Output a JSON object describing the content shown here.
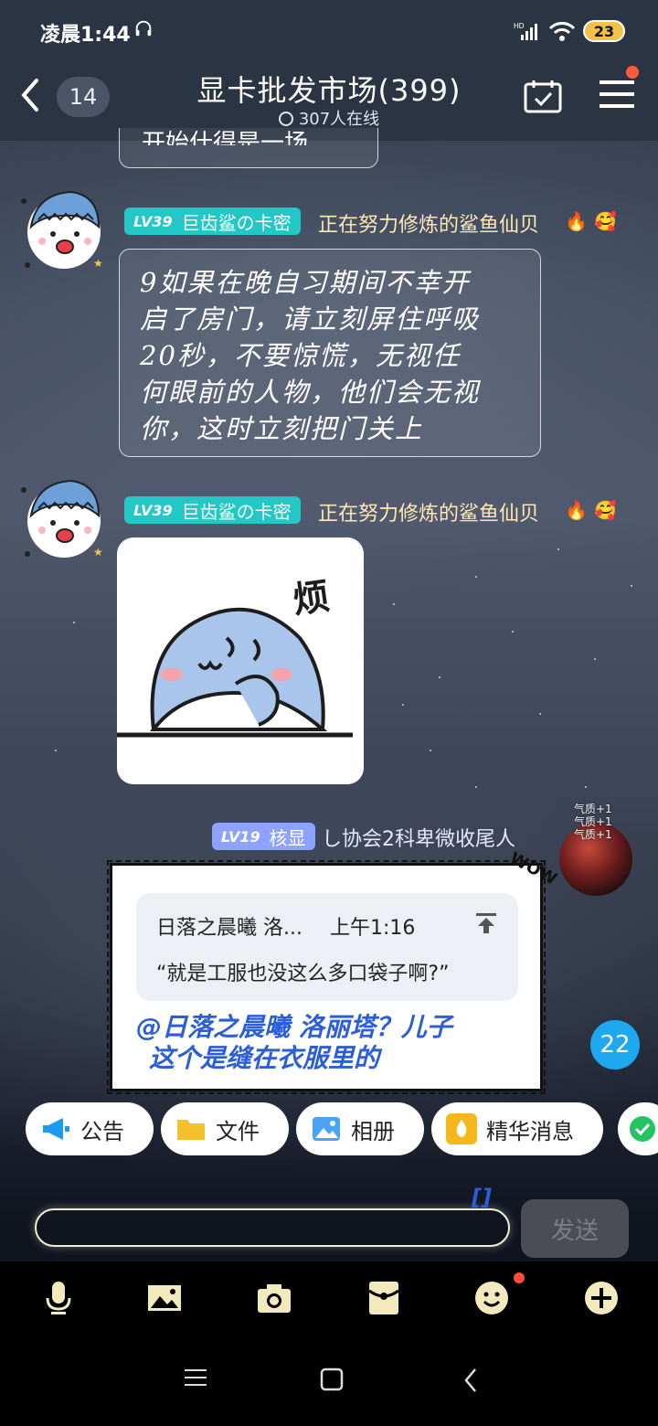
{
  "status_bar": {
    "time": "凌晨1:44",
    "battery": "23",
    "network": "HD"
  },
  "header": {
    "unread_count": "14",
    "title": "显卡批发市场(399)",
    "online": "307人在线"
  },
  "messages": [
    {
      "type": "partial_text",
      "text": "开始什得是一场"
    },
    {
      "type": "text",
      "level": "LV39",
      "name": "巨齿鲨の卡密",
      "title": "正在努力修炼的鲨鱼仙贝",
      "text_lines": [
        "9如果在晚自习期间不幸开",
        "启了房门，请立刻屏住呼吸",
        "20秒，不要惊慌，无视任",
        "何眼前的人物，他们会无视",
        "你，这时立刻把门关上"
      ]
    },
    {
      "type": "sticker",
      "level": "LV39",
      "name": "巨齿鲨の卡密",
      "title": "正在努力修炼的鲨鱼仙贝",
      "sticker_text": "烦"
    },
    {
      "type": "reply",
      "level": "LV19",
      "name": "核显",
      "title": "し协会2科卑微收尾人",
      "avatar_effects": [
        "气质+1",
        "气质+1",
        "气质+1"
      ],
      "quote": {
        "author": "日落之晨曦 洛...",
        "time": "上午1:16",
        "text": "“就是工服也没这么多口袋子啊?”"
      },
      "reply_lines": [
        "@日落之晨曦 洛丽塔？儿子",
        "这个是缝在衣服里的"
      ],
      "decoration": "WOW"
    }
  ],
  "unread_bubble": "22",
  "chips": [
    {
      "label": "公告",
      "icon": "megaphone-icon"
    },
    {
      "label": "文件",
      "icon": "folder-icon"
    },
    {
      "label": "相册",
      "icon": "album-icon"
    },
    {
      "label": "精华消息",
      "icon": "essence-icon"
    }
  ],
  "composer": {
    "send_label": "发送",
    "partial_text": "[]"
  },
  "toolbar": [
    "mic-icon",
    "image-icon",
    "camera-icon",
    "red-packet-icon",
    "emoji-icon",
    "plus-icon"
  ],
  "colors": {
    "header_bg": "#2b3443",
    "lv39": "#22c7c6",
    "lv19": "#8ea3ff",
    "reply_text": "#2b5ed8",
    "unread": "#1ea8f0"
  }
}
